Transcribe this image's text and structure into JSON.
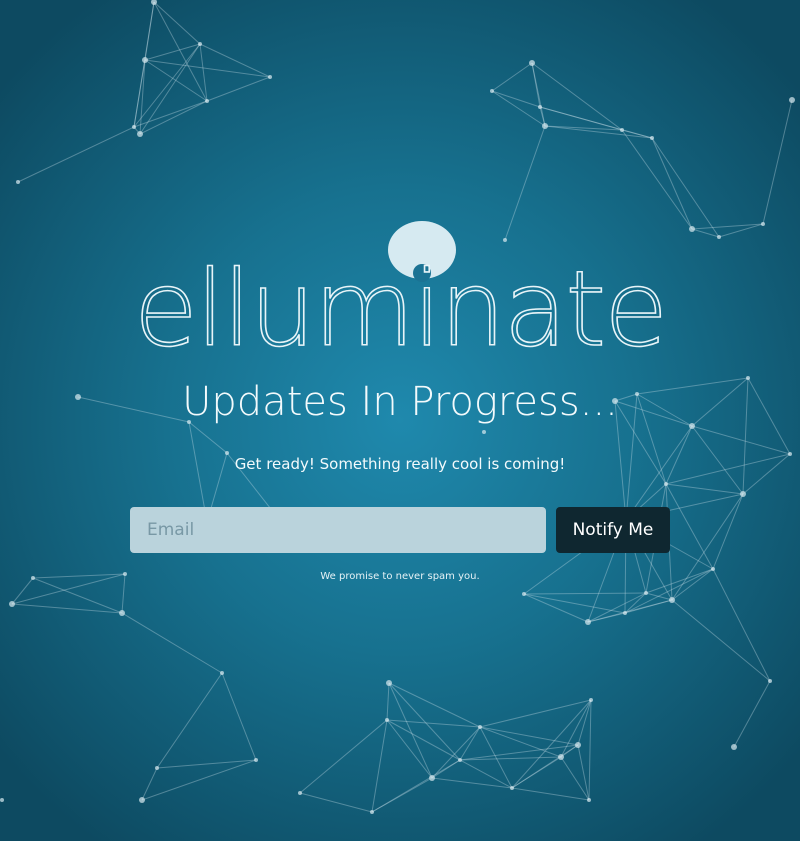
{
  "brand": {
    "logo_text": "elluminate"
  },
  "hero": {
    "headline": "Updates In Progress...",
    "subheadline": "Get ready! Something really cool is coming!"
  },
  "signup": {
    "email_placeholder": "Email",
    "email_value": "",
    "button_label": "Notify Me",
    "disclaimer": "We promise to never spam you."
  },
  "colors": {
    "background_center": "#1f89ad",
    "background_edge": "#0d4a61",
    "button_background": "#0f2730",
    "input_background": "#bad3dc",
    "network_lines": "#cfe3ea"
  },
  "decor": {
    "background_pattern": "connected-particles-network"
  }
}
